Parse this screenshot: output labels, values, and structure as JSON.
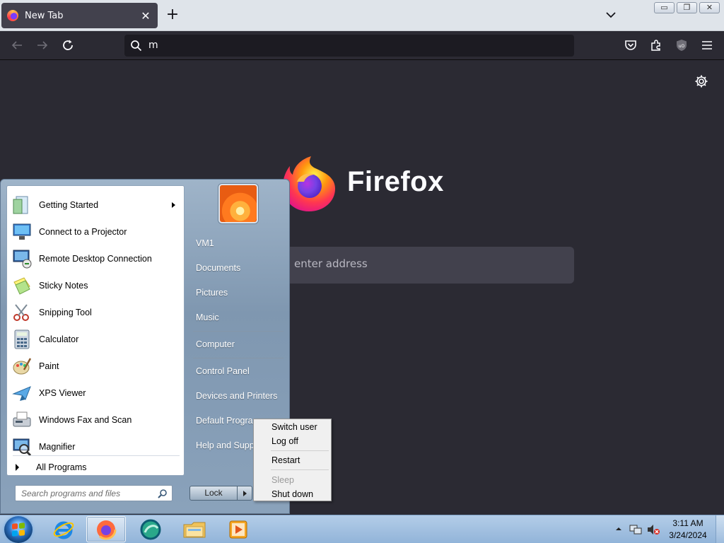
{
  "browser": {
    "tab": {
      "title": "New Tab",
      "close": "✕"
    },
    "new_tab": "+",
    "window_buttons": {
      "minimize": "▭",
      "restore": "❐",
      "close": "✕"
    },
    "address_bar": {
      "value": "m"
    },
    "home": {
      "wordmark": "Firefox",
      "search_placeholder": "enter address"
    }
  },
  "start_menu": {
    "programs": [
      {
        "label": "Getting Started",
        "icon": "getting-started-icon",
        "has_submenu": true
      },
      {
        "label": "Connect to a Projector",
        "icon": "projector-icon"
      },
      {
        "label": "Remote Desktop Connection",
        "icon": "remote-desktop-icon"
      },
      {
        "label": "Sticky Notes",
        "icon": "sticky-notes-icon"
      },
      {
        "label": "Snipping Tool",
        "icon": "snipping-tool-icon"
      },
      {
        "label": "Calculator",
        "icon": "calculator-icon"
      },
      {
        "label": "Paint",
        "icon": "paint-icon"
      },
      {
        "label": "XPS Viewer",
        "icon": "xps-viewer-icon"
      },
      {
        "label": "Windows Fax and Scan",
        "icon": "fax-scan-icon"
      },
      {
        "label": "Magnifier",
        "icon": "magnifier-icon"
      }
    ],
    "all_programs": "All Programs",
    "search_placeholder": "Search programs and files",
    "right_links": [
      "VM1",
      "Documents",
      "Pictures",
      "Music",
      "Computer",
      "Control Panel",
      "Devices and Printers",
      "Default Programs",
      "Help and Support"
    ],
    "lock_label": "Lock"
  },
  "power_menu": {
    "items": [
      {
        "label": "Switch user",
        "enabled": true
      },
      {
        "label": "Log off",
        "enabled": true
      },
      {
        "label": "Restart",
        "enabled": true
      },
      {
        "label": "Sleep",
        "enabled": false
      },
      {
        "label": "Shut down",
        "enabled": true
      }
    ]
  },
  "taskbar": {
    "pinned": [
      "internet-explorer-icon",
      "firefox-icon",
      "app-icon",
      "windows-explorer-icon",
      "media-player-icon"
    ],
    "active": "firefox-icon",
    "clock": {
      "time": "3:11 AM",
      "date": "3/24/2024"
    }
  },
  "colors": {
    "firefox_bg": "#2b2a33",
    "urlbar_bg": "#1c1b22",
    "taskbar": "#a6c4e3"
  }
}
